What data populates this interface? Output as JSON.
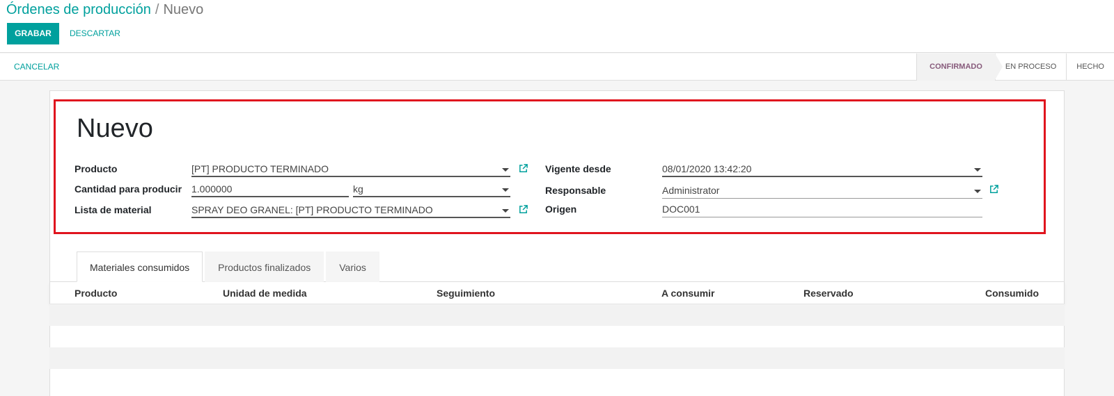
{
  "breadcrumb": {
    "parent": "Órdenes de producción",
    "separator": "/",
    "current": "Nuevo"
  },
  "toolbar": {
    "save_label": "GRABAR",
    "discard_label": "DESCARTAR"
  },
  "statusbar": {
    "cancel_label": "CANCELAR",
    "stages": [
      "CONFIRMADO",
      "EN PROCESO",
      "HECHO"
    ],
    "active_stage": "CONFIRMADO"
  },
  "form": {
    "title": "Nuevo",
    "left": {
      "product_label": "Producto",
      "product_value": "[PT] PRODUCTO TERMINADO",
      "qty_label": "Cantidad para producir",
      "qty_value": "1.000000",
      "uom_value": "kg",
      "bom_label": "Lista de material",
      "bom_value": "SPRAY DEO GRANEL: [PT] PRODUCTO TERMINADO"
    },
    "right": {
      "date_label": "Vigente desde",
      "date_value": "08/01/2020 13:42:20",
      "responsible_label": "Responsable",
      "responsible_value": "Administrator",
      "origin_label": "Origen",
      "origin_value": "DOC001"
    }
  },
  "tabs": [
    "Materiales consumidos",
    "Productos finalizados",
    "Varios"
  ],
  "active_tab": "Materiales consumidos",
  "table": {
    "columns": [
      "Producto",
      "Unidad de medida",
      "Seguimiento",
      "A consumir",
      "Reservado",
      "Consumido"
    ]
  },
  "colors": {
    "primary": "#00a09d",
    "active_stage": "#875a7b",
    "highlight": "#e0141e"
  },
  "icons": {
    "external_link": "external-link-icon",
    "dropdown": "chevron-down-icon"
  }
}
